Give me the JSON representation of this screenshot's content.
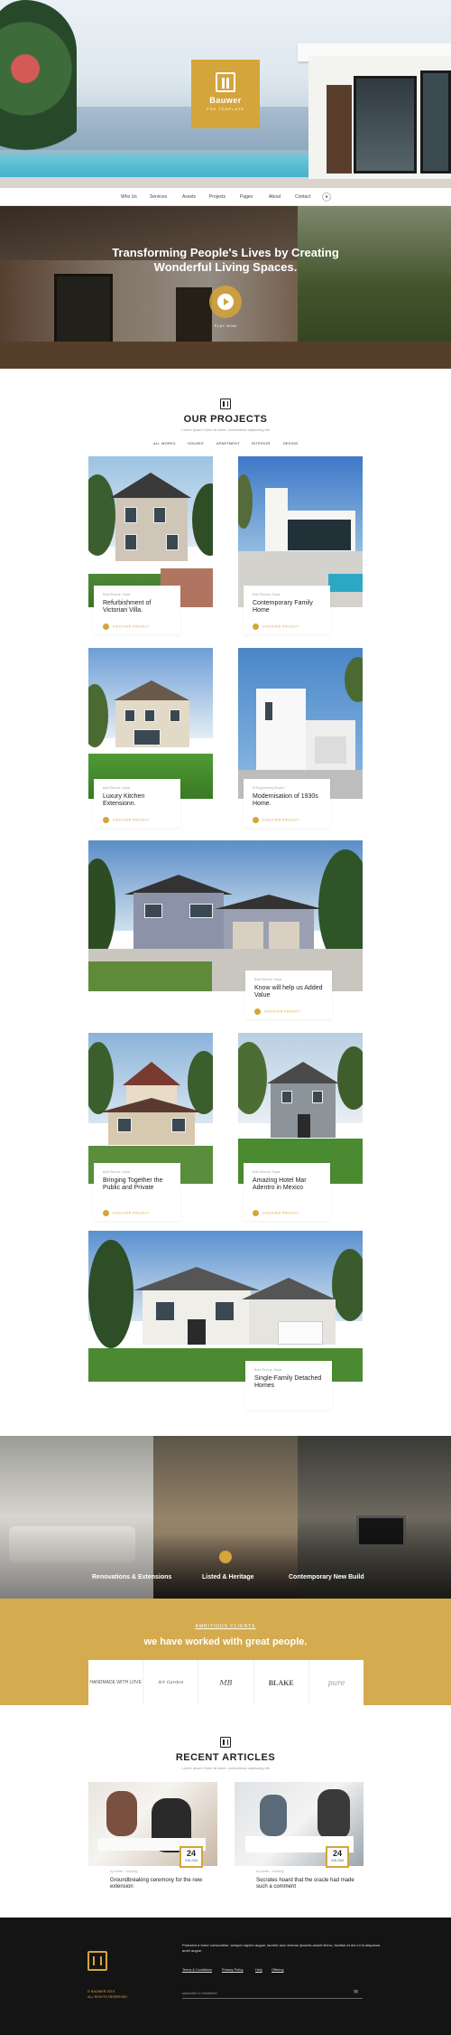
{
  "brand": {
    "name": "Bauwer",
    "tagline": "PSD TEMPLATE"
  },
  "nav": {
    "items": [
      "Who Us",
      "Services",
      "Assets",
      "Projects",
      "Pages",
      "About",
      "Contact"
    ]
  },
  "banner": {
    "title": "Transforming People's Lives by Creating Wonderful Living Spaces.",
    "play_label": "PLAY NOW"
  },
  "projects": {
    "title": "OUR PROJECTS",
    "subtitle": "Lorem Ipsum Dolor sit amet, consectetur adipiscing elit",
    "filters": [
      "ALL WORKS",
      "HOUSES",
      "APARTMENT",
      "INTERIOR",
      "DESIGN"
    ],
    "link_label": "DISCOVER PROJECT",
    "items": [
      {
        "meta": "Bold Revival, Sepia",
        "title": "Refurbishment of Victorian Villa."
      },
      {
        "meta": "Bold Revival, Sepia",
        "title": "Contemporary Family Home"
      },
      {
        "meta": "Bold Revival, Sepia",
        "title": "Luxury Kitchen Extensionn."
      },
      {
        "meta": "El Engineering Modern",
        "title": "Modernisation of 1930s Home."
      },
      {
        "meta": "Bold Revival, Sepia",
        "title": "Know will help us Added Value"
      },
      {
        "meta": "Bold Revival, Sepia",
        "title": "Bringing Together the Public and Private"
      },
      {
        "meta": "Bold Revival, Sepia",
        "title": "Amazing Hotel Mar Adentro in Mexico"
      },
      {
        "meta": "Bold Revival, Sepia",
        "title": "Single-Family Detached Homes"
      }
    ]
  },
  "services": {
    "items": [
      "Renovations & Extensions",
      "Listed & Heritage",
      "Contemporary New Build"
    ]
  },
  "clients": {
    "kicker": "AMBITIOUS CLIENTS",
    "title": "we have worked with great people.",
    "logos": [
      "HANDMADE WITH LOVE",
      "Art Garden",
      "MB",
      "BLAKE",
      "pure"
    ]
  },
  "articles": {
    "title": "RECENT ARTICLES",
    "subtitle": "Lorem Ipsum Dolor sit amet, consectetur adipiscing elit",
    "items": [
      {
        "day": "24",
        "month": "JUN 2016",
        "meta": "by Admin  ·  Housing",
        "title": "Groundbreaking ceremony for the new extension"
      },
      {
        "day": "24",
        "month": "JUN 2016",
        "meta": "by Admin  ·  Housing",
        "title": "Socrates hoard that the oracle had made such a comment"
      }
    ]
  },
  "footer": {
    "copyright_line1": "© BAUWER 2019",
    "copyright_line2": "ALL RIGHTS RESERVED",
    "text": "Praesent a tortor consectetur, semper sapien augue, laoreet arcu termas ipsumis assert libero, facilisis et dui mi la aliquama amet augue.",
    "links": [
      "Terms & Conditions",
      "Privacy Policy",
      "Help",
      "Offering"
    ],
    "newsletter_placeholder": "subscribe to newsletter"
  },
  "colors": {
    "accent": "#d4a53a",
    "dark": "#141414"
  },
  "icons": {
    "play": "play-icon",
    "user": "user-icon",
    "send": "send-icon"
  }
}
